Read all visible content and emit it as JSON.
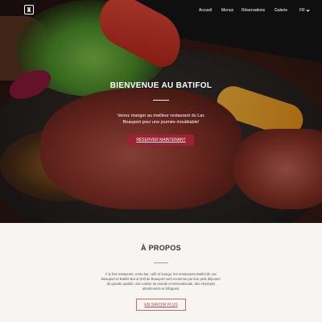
{
  "nav": {
    "items": [
      "Accueil",
      "Menus",
      "Réservations",
      "Galerie"
    ],
    "language": "FR"
  },
  "hero": {
    "title": "BIENVENUE AU BATIFOL",
    "subtitle": "Venez manger au meilleur restaurant du Lac Beauport pour une journée inoubliable!",
    "button": "RÉSERVER MAINTENANT"
  },
  "about": {
    "title": "À PROPOS",
    "text": "À la fois restaurant, resto-bar, café et lounge, les restaurants Batifol de Lac Beauport et Batifol Bar & Grill de Beauport sont reconnus par leur petit déjeuner de grande qualité, une cuisine du monde et internationale, des employés attentionnés et bilingues.",
    "button": "EN SAVOIR PLUS"
  },
  "colors": {
    "accent": "#9c2432",
    "about_button": "#c96a6a"
  },
  "icons": [
    "logo-icon",
    "chevron-down-icon"
  ]
}
